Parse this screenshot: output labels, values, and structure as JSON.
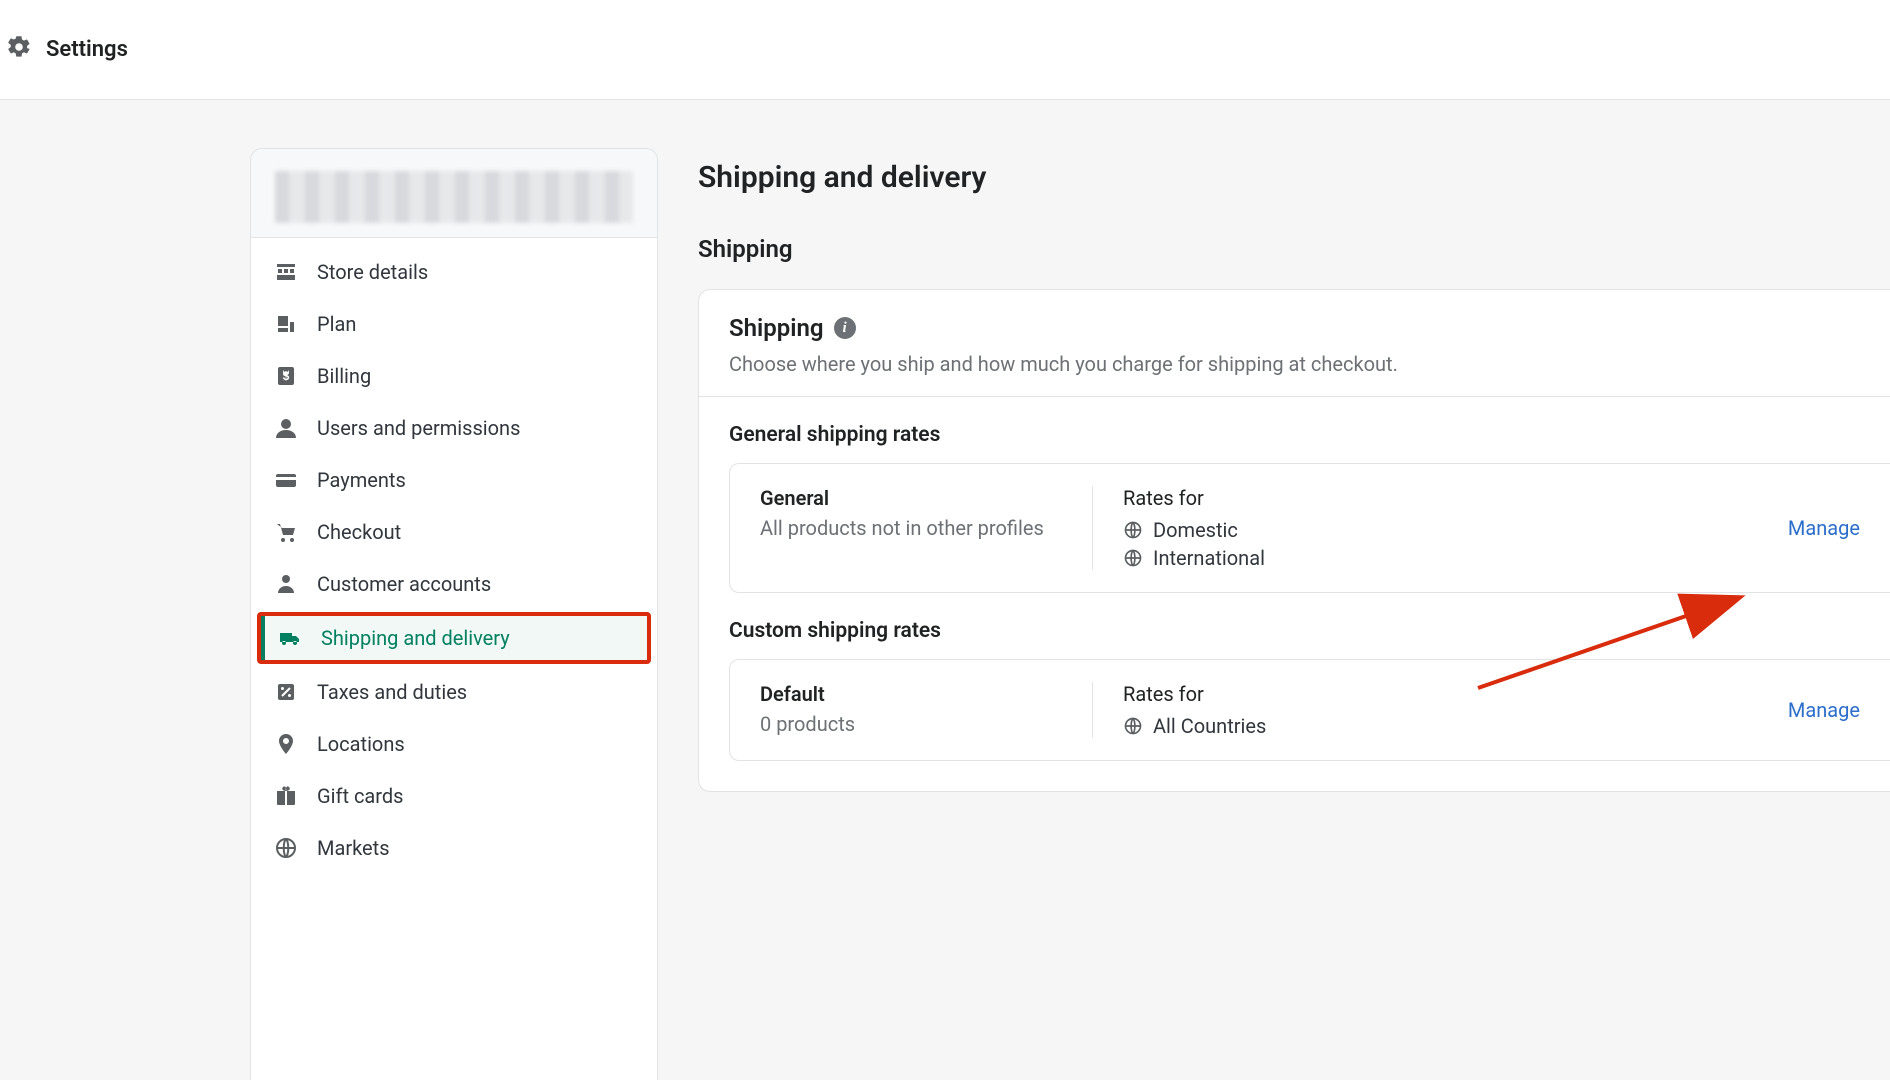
{
  "header": {
    "title": "Settings"
  },
  "sidebar": {
    "items": [
      {
        "id": "store-details",
        "label": "Store details",
        "icon": "store-icon"
      },
      {
        "id": "plan",
        "label": "Plan",
        "icon": "plan-icon"
      },
      {
        "id": "billing",
        "label": "Billing",
        "icon": "billing-icon"
      },
      {
        "id": "users",
        "label": "Users and permissions",
        "icon": "user-icon"
      },
      {
        "id": "payments",
        "label": "Payments",
        "icon": "card-icon"
      },
      {
        "id": "checkout",
        "label": "Checkout",
        "icon": "cart-icon"
      },
      {
        "id": "customer-accounts",
        "label": "Customer accounts",
        "icon": "person-icon"
      },
      {
        "id": "shipping",
        "label": "Shipping and delivery",
        "icon": "truck-icon",
        "active": true,
        "highlighted": true
      },
      {
        "id": "taxes",
        "label": "Taxes and duties",
        "icon": "percent-icon"
      },
      {
        "id": "locations",
        "label": "Locations",
        "icon": "pin-icon"
      },
      {
        "id": "gift-cards",
        "label": "Gift cards",
        "icon": "gift-icon"
      },
      {
        "id": "markets",
        "label": "Markets",
        "icon": "globe-icon"
      }
    ]
  },
  "page": {
    "title": "Shipping and delivery",
    "section_label": "Shipping",
    "card_title": "Shipping",
    "card_desc": "Choose where you ship and how much you charge for shipping at checkout.",
    "general": {
      "heading": "General shipping rates",
      "name": "General",
      "sub": "All products not in other profiles",
      "rates_label": "Rates for",
      "rates": [
        "Domestic",
        "International"
      ],
      "manage": "Manage"
    },
    "custom": {
      "heading": "Custom shipping rates",
      "name": "Default",
      "sub": "0 products",
      "rates_label": "Rates for",
      "rates": [
        "All Countries"
      ],
      "manage": "Manage"
    }
  },
  "colors": {
    "accent": "#008060",
    "link": "#2c6ecb",
    "highlight": "#d82c0d"
  }
}
